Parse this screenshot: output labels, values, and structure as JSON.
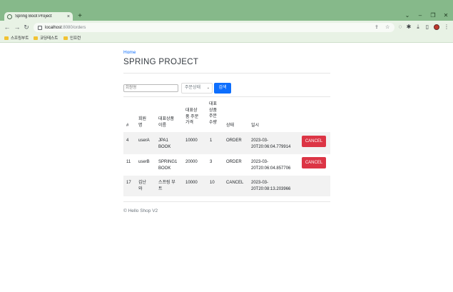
{
  "browser": {
    "tab_title": "Spring Boot Project",
    "tab_close": "×",
    "new_tab": "+",
    "url_host": "localhost",
    "url_path": ":8080/orders",
    "bookmarks": [
      "스프링부트",
      "코딩테스트",
      "인프런"
    ]
  },
  "page": {
    "breadcrumb": "Home",
    "title": "SPRING PROJECT",
    "search": {
      "name_placeholder": "회원명",
      "status_label": "주문상태",
      "search_button": "검색"
    },
    "table": {
      "headers": {
        "id": "#",
        "member": [
          "회원",
          "명"
        ],
        "item": [
          "대표상품",
          "이름"
        ],
        "price": [
          "대표상",
          "품 주문",
          "가격"
        ],
        "count": [
          "대표",
          "상품",
          "주문",
          "수량"
        ],
        "status": "상태",
        "date": "일시"
      },
      "rows": [
        {
          "id": "4",
          "member": [
            "userA"
          ],
          "item": [
            "JPA1",
            "BOOK"
          ],
          "price": "10000",
          "count": "1",
          "status": "ORDER",
          "date": [
            "2023-03-",
            "20T20:06:04.779914"
          ],
          "action": "CANCEL"
        },
        {
          "id": "11",
          "member": [
            "userB"
          ],
          "item": [
            "SPRING1",
            "BOOK"
          ],
          "price": "20000",
          "count": "3",
          "status": "ORDER",
          "date": [
            "2023-03-",
            "20T20:06:04.857706"
          ],
          "action": "CANCEL"
        },
        {
          "id": "17",
          "member": [
            "김난",
            "와"
          ],
          "item": [
            "스프링 부",
            "트"
          ],
          "price": "10000",
          "count": "10",
          "status": "CANCEL",
          "date": [
            "2023-03-",
            "20T20:08:13.203966"
          ],
          "action": ""
        }
      ]
    },
    "footer": "© Hello Shop V2"
  },
  "colors": {
    "chrome_frame": "#86b98a",
    "primary": "#0d6efd",
    "danger": "#dc3545"
  }
}
